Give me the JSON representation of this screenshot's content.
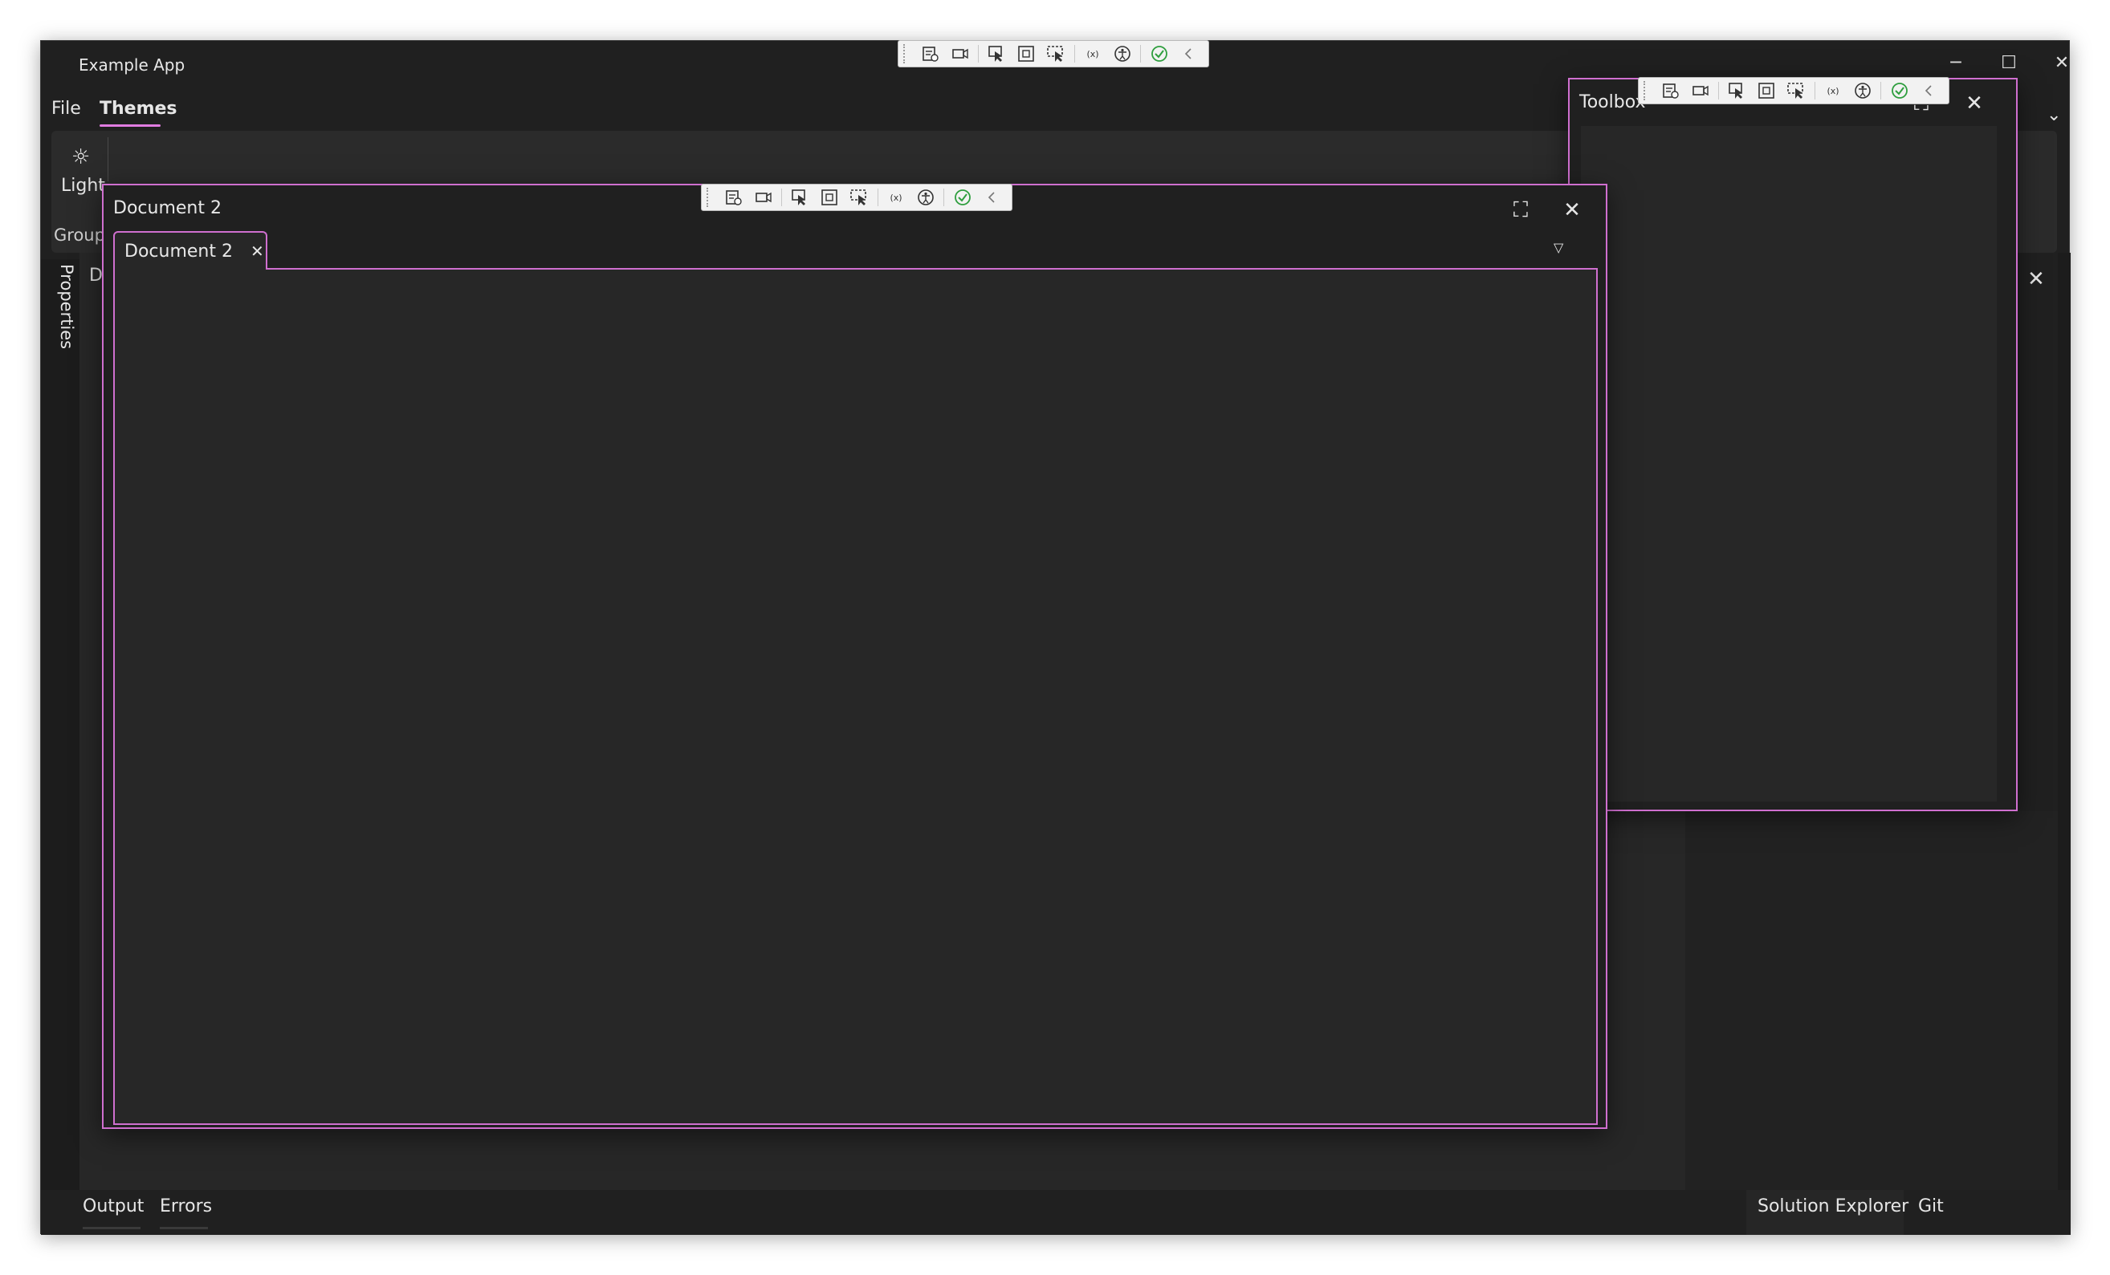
{
  "app": {
    "title": "Example App",
    "controls": {
      "minimize": "─",
      "maximize": "☐",
      "close": "✕"
    }
  },
  "menu": {
    "items": [
      "File",
      "Themes"
    ],
    "active": "Themes"
  },
  "ribbon": {
    "light_icon": "☼",
    "light_label": "Light",
    "group_label": "Group",
    "collapse_chevron": "⌄"
  },
  "sidebar": {
    "properties_label": "Properties"
  },
  "background_doc": {
    "partial_char": "D",
    "close": "✕"
  },
  "document_window": {
    "title": "Document 2",
    "maximize": "⛶",
    "close": "✕",
    "tab": {
      "label": "Document 2",
      "close": "✕"
    },
    "overflow_icon": "▽"
  },
  "toolbox_window": {
    "title": "Toolbox",
    "maximize": "⛶",
    "close": "✕"
  },
  "bottom_tabs": [
    "Output",
    "Errors"
  ],
  "right_bottom_tabs": [
    "Solution Explorer",
    "Git"
  ],
  "colors": {
    "accent": "#cf6fcf",
    "window_bg": "#202020",
    "panel_bg": "#272727",
    "toolbar_bg": "#f2f2f2",
    "check_green": "#2e9e3e"
  },
  "debug_toolbar_icons": [
    "live-visual-tree-icon",
    "record-icon",
    "select-element-icon",
    "display-layout-adorners-icon",
    "track-focus-icon",
    "binding-failures-icon",
    "accessibility-icon",
    "check-icon",
    "collapse-icon"
  ]
}
